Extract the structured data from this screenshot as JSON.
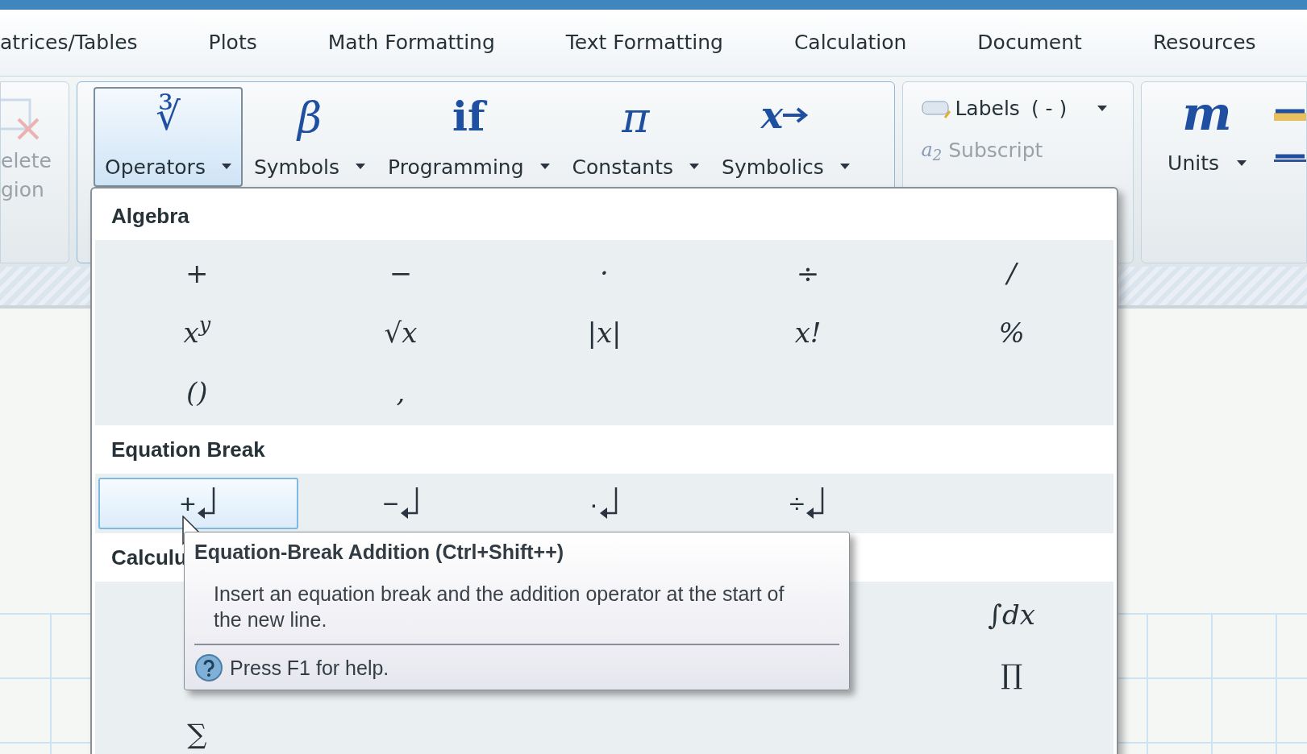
{
  "menu_tabs": [
    {
      "label": "atrices/Tables"
    },
    {
      "label": "Plots"
    },
    {
      "label": "Math Formatting"
    },
    {
      "label": "Text Formatting"
    },
    {
      "label": "Calculation"
    },
    {
      "label": "Document"
    },
    {
      "label": "Resources"
    }
  ],
  "ribbon": {
    "region_group": {
      "lines": [
        "elete",
        "gion"
      ],
      "disabled": true
    },
    "gallery_buttons": [
      {
        "glyph": "∛",
        "label": "Operators",
        "selected": true,
        "kind": "root"
      },
      {
        "glyph": "β",
        "label": "Symbols",
        "selected": false,
        "kind": "greek"
      },
      {
        "glyph": "if",
        "label": "Programming",
        "selected": false,
        "kind": "word"
      },
      {
        "glyph": "π",
        "label": "Constants",
        "selected": false,
        "kind": "greek"
      },
      {
        "glyph": "x",
        "label": "Symbolics",
        "selected": false,
        "kind": "arrow"
      }
    ],
    "labels": {
      "label": "Labels",
      "value": "( - )"
    },
    "subscript": {
      "glyph": "a$_{2}$",
      "label": "Subscript",
      "disabled": true
    },
    "units": {
      "glyph": "m",
      "label": "Units"
    }
  },
  "dropdown": {
    "sections": [
      {
        "title": "Algebra",
        "kind": "grid",
        "rows": [
          [
            "+",
            "−",
            "·",
            "÷",
            "/"
          ],
          [
            "x$^{y}$",
            "√x",
            "|x|",
            "x!",
            "%"
          ],
          [
            "()",
            ",",
            null,
            null,
            null
          ]
        ]
      },
      {
        "title": "Equation Break",
        "kind": "breaks",
        "items": [
          {
            "op": "+",
            "selected": true
          },
          {
            "op": "−",
            "selected": false
          },
          {
            "op": "·",
            "selected": false
          },
          {
            "op": "÷",
            "selected": false
          }
        ]
      },
      {
        "title": "Calculu",
        "kind": "grid",
        "rows": [
          [
            null,
            null,
            null,
            null,
            "∫dx"
          ],
          [
            null,
            null,
            null,
            null,
            "∏"
          ],
          [
            "∑",
            null,
            null,
            null,
            null
          ]
        ]
      }
    ]
  },
  "tooltip": {
    "title": "Equation-Break Addition (Ctrl+Shift++)",
    "body": "Insert an equation break and the addition operator at the start of the new line.",
    "help": "Press F1 for help."
  }
}
